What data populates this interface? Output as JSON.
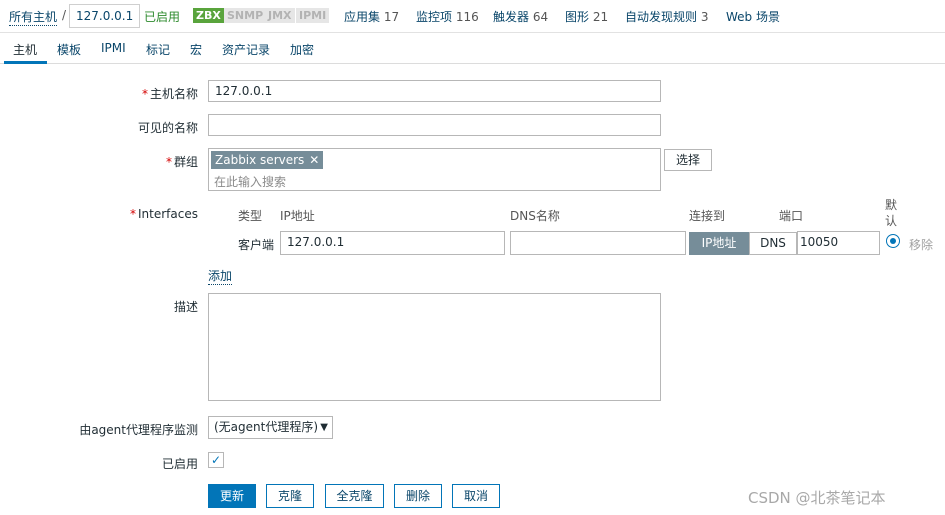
{
  "breadcrumb": {
    "all_hosts": "所有主机",
    "separator": "/",
    "current": "127.0.0.1"
  },
  "host_status": "已启用",
  "availability": {
    "zbx": "ZBX",
    "snmp": "SNMP",
    "jmx": "JMX",
    "ipmi": "IPMI"
  },
  "top_links": [
    {
      "label": "应用集",
      "count": "17"
    },
    {
      "label": "监控项",
      "count": "116"
    },
    {
      "label": "触发器",
      "count": "64"
    },
    {
      "label": "图形",
      "count": "21"
    },
    {
      "label": "自动发现规则",
      "count": "3"
    },
    {
      "label": "Web 场景",
      "count": ""
    }
  ],
  "tabs": [
    "主机",
    "模板",
    "IPMI",
    "标记",
    "宏",
    "资产记录",
    "加密"
  ],
  "form": {
    "required_mark": "*",
    "hostname_label": "主机名称",
    "hostname_value": "127.0.0.1",
    "visible_name_label": "可见的名称",
    "visible_name_value": "",
    "groups_label": "群组",
    "group_chip": "Zabbix servers",
    "group_chip_remove": "✕",
    "groups_placeholder": "在此输入搜索",
    "select_button": "选择",
    "interfaces_label": "Interfaces",
    "iface_headers": {
      "type": "类型",
      "ip": "IP地址",
      "dns": "DNS名称",
      "connect": "连接到",
      "port": "端口",
      "default": "默认"
    },
    "iface_row": {
      "type": "客户端",
      "ip": "127.0.0.1",
      "dns": "",
      "connect_ip": "IP地址",
      "connect_dns": "DNS",
      "port": "10050",
      "remove": "移除"
    },
    "add_link": "添加",
    "description_label": "描述",
    "description_value": "",
    "proxy_label": "由agent代理程序监测",
    "proxy_value": "(无agent代理程序)",
    "enabled_label": "已启用",
    "enabled_check": "✓"
  },
  "buttons": {
    "update": "更新",
    "clone": "克隆",
    "full_clone": "全克隆",
    "delete": "删除",
    "cancel": "取消"
  },
  "watermark": "CSDN @北茶笔记本",
  "colors": {
    "accent": "#0275b8",
    "enabled": "#59a43c",
    "required": "#d40000"
  }
}
